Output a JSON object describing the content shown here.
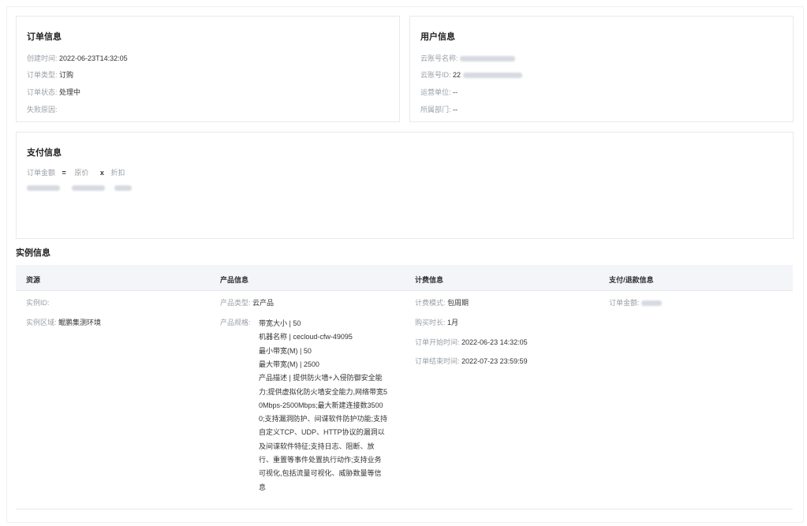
{
  "order_info": {
    "title": "订单信息",
    "created_label": "创建时间:",
    "created_value": "2022-06-23T14:32:05",
    "type_label": "订单类型:",
    "type_value": "订购",
    "status_label": "订单状态:",
    "status_value": "处理中",
    "fail_label": "失败原因:",
    "fail_value": ""
  },
  "user_info": {
    "title": "用户信息",
    "account_name_label": "云账号名称:",
    "account_id_label": "云账号ID:",
    "account_id_prefix": "22",
    "operator_label": "运营单位:",
    "operator_value": "--",
    "dept_label": "所属部门:",
    "dept_value": "--"
  },
  "payment_info": {
    "title": "支付信息",
    "amount_label": "订单金额",
    "eq": "=",
    "original_label": "原价",
    "times": "x",
    "discount_label": "折扣"
  },
  "instance_info": {
    "title": "实例信息",
    "columns": [
      "资源",
      "产品信息",
      "计费信息",
      "支付/退款信息"
    ],
    "resource": {
      "id_label": "实例ID:",
      "region_label": "实例区域:",
      "region_value": "鲲鹏集测环境"
    },
    "product": {
      "type_label": "产品类型:",
      "type_value": "云产品",
      "spec_label": "产品规格:",
      "spec_lines": [
        "带宽大小 | 50",
        "机器名称 | cecloud-cfw-49095",
        "最小带宽(M) | 50",
        "最大带宽(M) | 2500",
        "产品描述 | 提供防火墙+入侵防御安全能",
        "力;提供虚拟化防火墙安全能力,网络带宽5",
        "0Mbps-2500Mbps;最大新建连接数3500",
        "0;支持漏洞防护、间谍软件防护功能;支持",
        "自定义TCP、UDP、HTTP协议的漏洞以",
        "及间谍软件特征;支持日志、阻断、放",
        "行、重置等事件处置执行动作;支持业务",
        "可视化,包括流量可视化、威胁数量等信",
        "息"
      ]
    },
    "billing": {
      "mode_label": "计费模式:",
      "mode_value": "包周期",
      "duration_label": "购买时长:",
      "duration_value": "1月",
      "start_label": "订单开始时间:",
      "start_value": "2022-06-23 14:32:05",
      "end_label": "订单结束时间:",
      "end_value": "2022-07-23 23:59:59"
    },
    "pay": {
      "amount_label": "订单金额:"
    }
  }
}
